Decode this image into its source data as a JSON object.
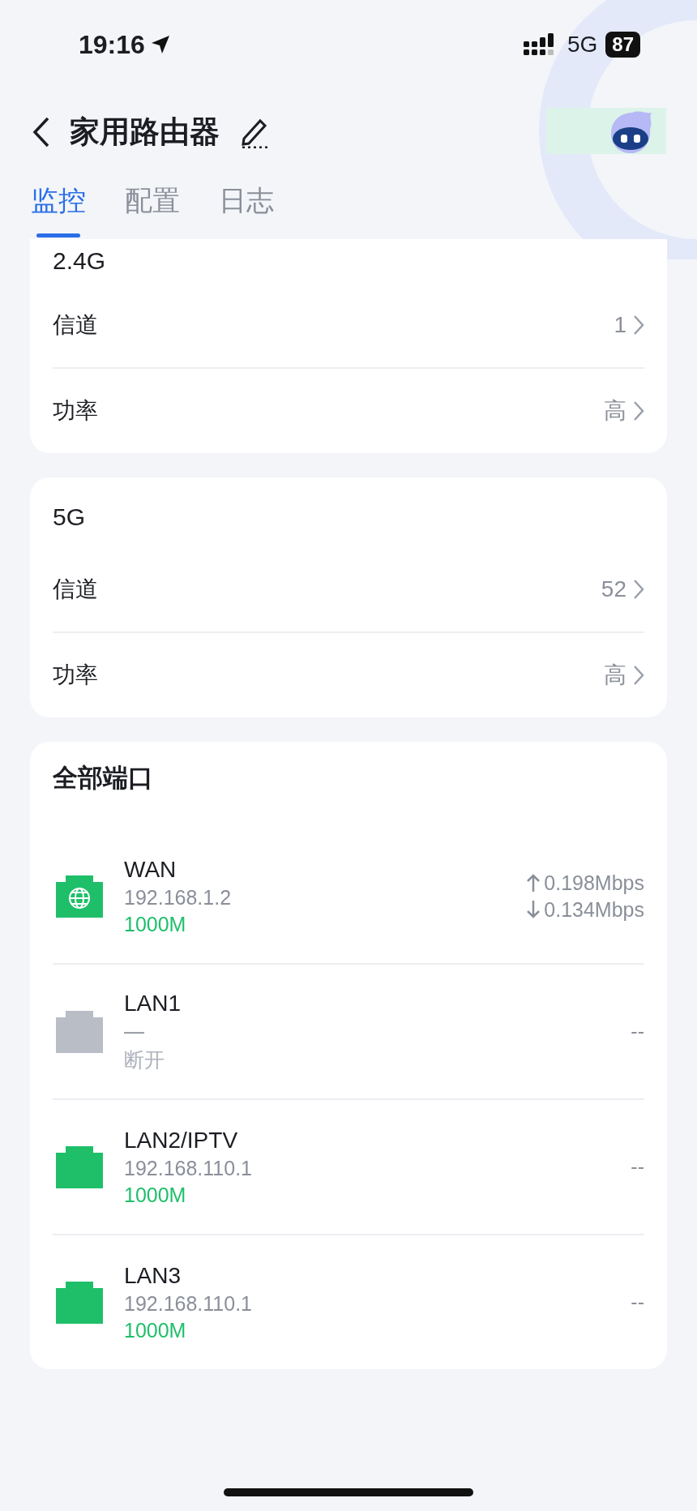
{
  "status_bar": {
    "time": "19:16",
    "network": "5G",
    "battery": "87"
  },
  "header": {
    "title": "家用路由器"
  },
  "tabs": [
    {
      "label": "监控",
      "selected": true
    },
    {
      "label": "配置",
      "selected": false
    },
    {
      "label": "日志",
      "selected": false
    }
  ],
  "radio_cards": [
    {
      "title": "2.4G",
      "rows": [
        {
          "label": "信道",
          "value": "1"
        },
        {
          "label": "功率",
          "value": "高"
        }
      ]
    },
    {
      "title": "5G",
      "rows": [
        {
          "label": "信道",
          "value": "52"
        },
        {
          "label": "功率",
          "value": "高"
        }
      ]
    }
  ],
  "ports": {
    "title": "全部端口",
    "items": [
      {
        "name": "WAN",
        "kind": "wan",
        "connected": true,
        "ip": "192.168.1.2",
        "speed": "1000M",
        "upload": "0.198Mbps",
        "download": "0.134Mbps"
      },
      {
        "name": "LAN1",
        "kind": "lan",
        "connected": false,
        "ip": "—",
        "speed": "断开",
        "traffic": "--"
      },
      {
        "name": "LAN2/IPTV",
        "kind": "lan",
        "connected": true,
        "ip": "192.168.110.1",
        "speed": "1000M",
        "traffic": "--"
      },
      {
        "name": "LAN3",
        "kind": "lan",
        "connected": true,
        "ip": "192.168.110.1",
        "speed": "1000M",
        "traffic": "--"
      }
    ]
  }
}
